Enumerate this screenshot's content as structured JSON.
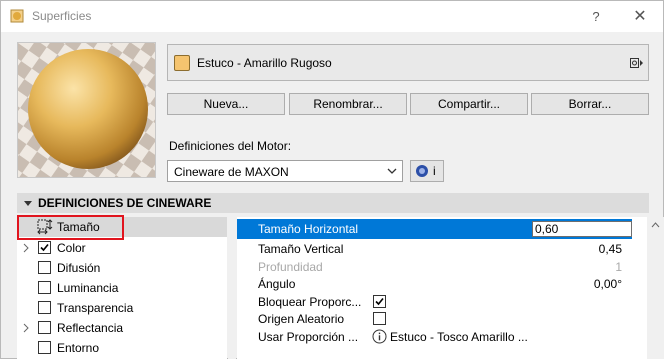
{
  "window": {
    "title": "Superficies",
    "help_label": "?",
    "close_label": "✕"
  },
  "material": {
    "name": "Estuco - Amarillo Rugoso",
    "swatch_color": "#f5c46f"
  },
  "actions": {
    "new_label": "Nueva...",
    "rename_label": "Renombrar...",
    "share_label": "Compartir...",
    "delete_label": "Borrar..."
  },
  "engine": {
    "label": "Definiciones del Motor:",
    "selected": "Cineware de MAXON",
    "info_label": "i"
  },
  "section": {
    "title": "DEFINICIONES DE CINEWARE"
  },
  "channels": [
    {
      "label": "Tamaño",
      "checkbox": false,
      "checked": false,
      "expandable": false,
      "selected": true,
      "icon": "size-icon"
    },
    {
      "label": "Color",
      "checkbox": true,
      "checked": true,
      "expandable": true,
      "selected": false
    },
    {
      "label": "Difusión",
      "checkbox": true,
      "checked": false,
      "expandable": false,
      "selected": false
    },
    {
      "label": "Luminancia",
      "checkbox": true,
      "checked": false,
      "expandable": false,
      "selected": false
    },
    {
      "label": "Transparencia",
      "checkbox": true,
      "checked": false,
      "expandable": false,
      "selected": false
    },
    {
      "label": "Reflectancia",
      "checkbox": true,
      "checked": false,
      "expandable": true,
      "selected": false
    },
    {
      "label": "Entorno",
      "checkbox": true,
      "checked": false,
      "expandable": false,
      "selected": false
    }
  ],
  "properties": [
    {
      "name": "Tamaño Horizontal",
      "value": "0,60",
      "type": "input",
      "selected": true
    },
    {
      "name": "Tamaño Vertical",
      "value": "0,45",
      "type": "text"
    },
    {
      "name": "Profundidad",
      "value": "1",
      "type": "text",
      "disabled": true
    },
    {
      "name": "Ángulo",
      "value": "0,00°",
      "type": "text"
    },
    {
      "name": "Bloquear Proporc...",
      "checked": true,
      "type": "checkbox"
    },
    {
      "name": "Origen Aleatorio",
      "checked": false,
      "type": "checkbox"
    },
    {
      "name": "Usar Proporción ...",
      "value": "Estuco - Tosco Amarillo ...",
      "type": "link"
    }
  ],
  "colors": {
    "selection": "#0078d7",
    "highlight_box": "#e1141e"
  }
}
